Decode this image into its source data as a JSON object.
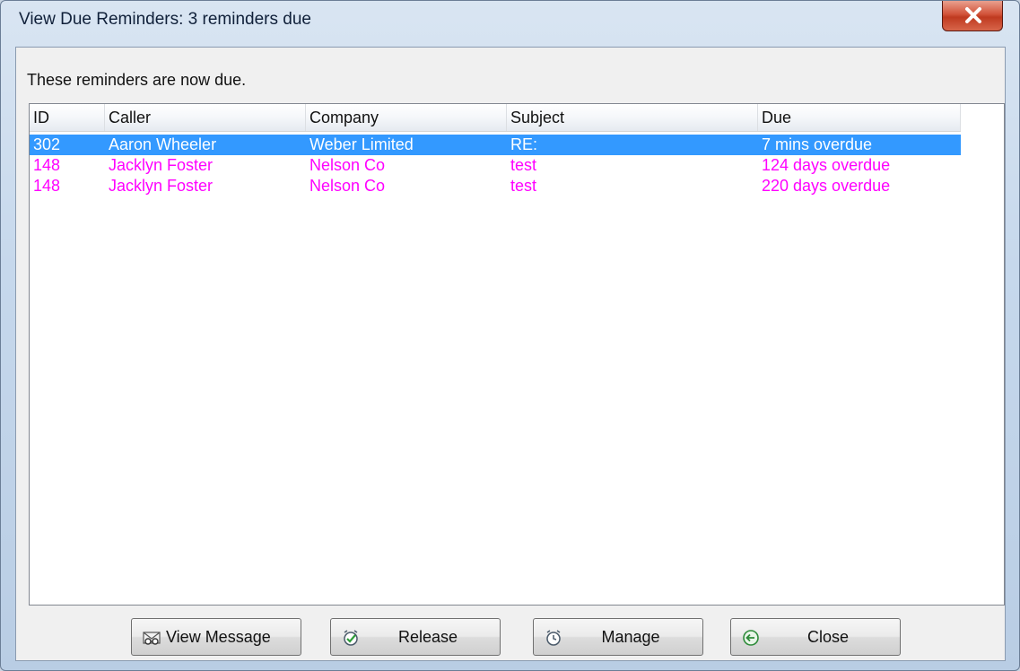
{
  "window": {
    "title": "View Due Reminders: 3 reminders due"
  },
  "instructions": "These reminders are now due.",
  "list": {
    "columns": [
      "ID",
      "Caller",
      "Company",
      "Subject",
      "Due"
    ],
    "rows": [
      {
        "id": "302",
        "caller": "Aaron Wheeler",
        "company": "Weber Limited",
        "subject": "RE:",
        "due": "7 mins overdue",
        "selected": true
      },
      {
        "id": "148",
        "caller": "Jacklyn Foster",
        "company": "Nelson Co",
        "subject": "test",
        "due": "124 days overdue",
        "selected": false
      },
      {
        "id": "148",
        "caller": "Jacklyn Foster",
        "company": "Nelson Co",
        "subject": "test",
        "due": "220 days overdue",
        "selected": false
      }
    ]
  },
  "buttons": {
    "view_message": {
      "label": "View Message",
      "icon": "view-message-icon"
    },
    "release": {
      "label": "Release",
      "icon": "release-icon"
    },
    "manage": {
      "label": "Manage",
      "icon": "alarm-clock-icon"
    },
    "close": {
      "label": "Close",
      "icon": "back-arrow-icon"
    }
  },
  "colors": {
    "selection": "#3399ff",
    "overdue_text": "#ff00ff",
    "close_button": "#c7462c"
  }
}
